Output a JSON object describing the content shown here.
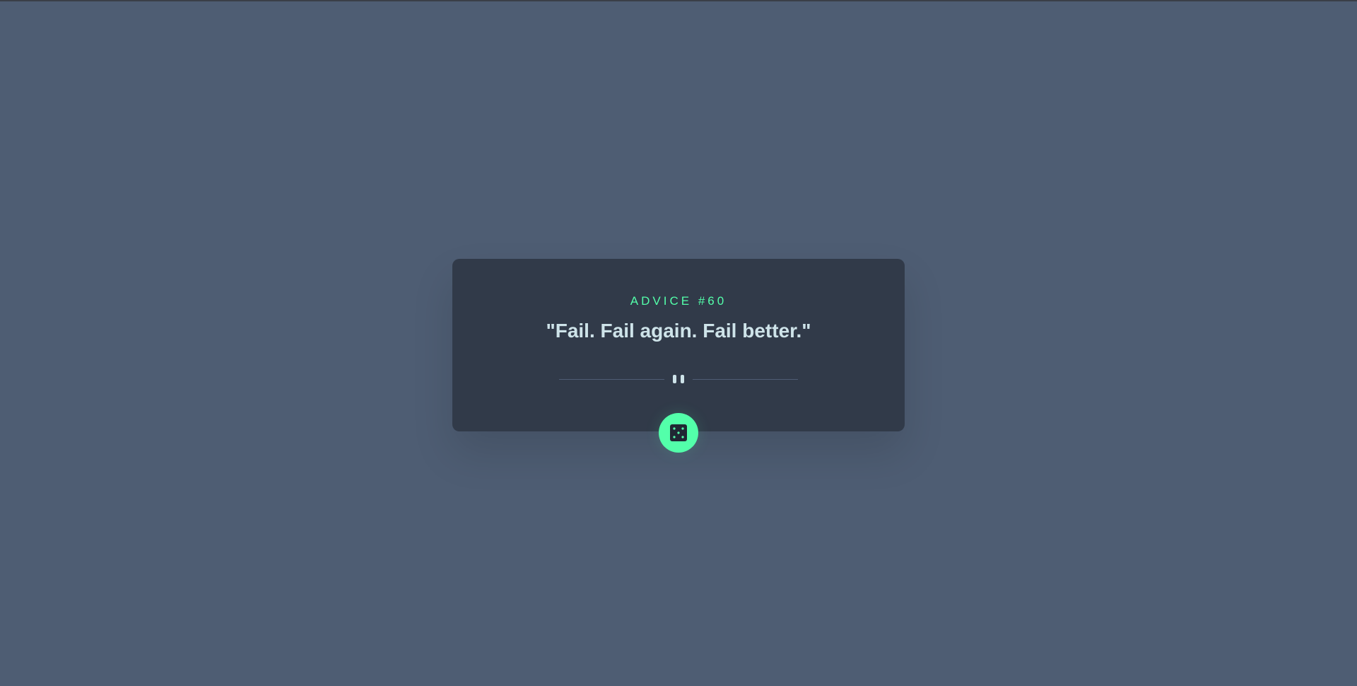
{
  "advice": {
    "label": "ADVICE #60",
    "quote": "\"Fail. Fail again. Fail better.\""
  },
  "icons": {
    "divider": "pause-icon",
    "button": "dice-icon"
  },
  "colors": {
    "background": "#4e5d73",
    "card": "#313a49",
    "accent": "#53ffaa",
    "text": "#cee3e9"
  }
}
